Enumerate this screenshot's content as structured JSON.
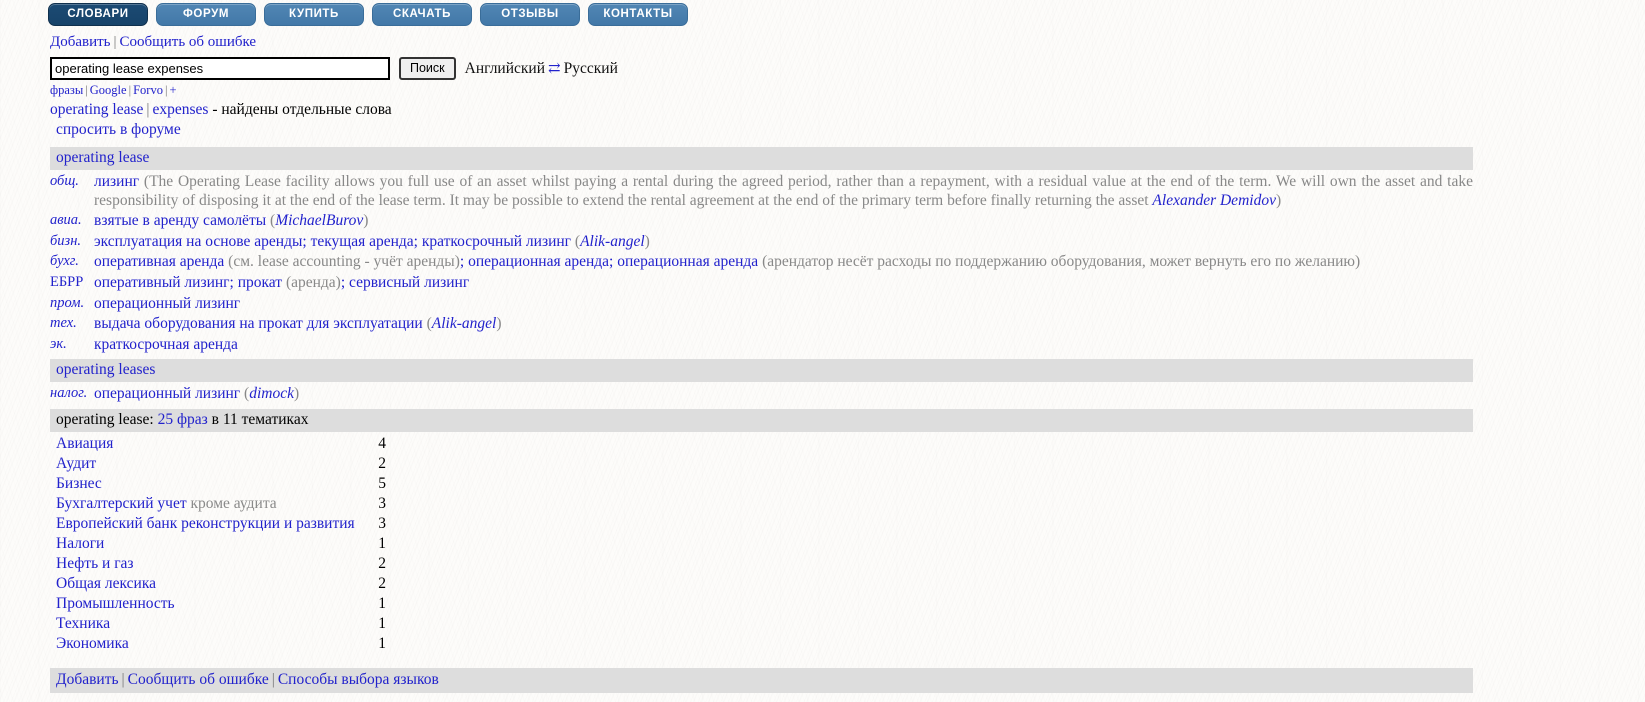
{
  "nav": {
    "items": [
      {
        "label": "СЛОВАРИ",
        "active": true
      },
      {
        "label": "ФОРУМ",
        "active": false
      },
      {
        "label": "КУПИТЬ",
        "active": false
      },
      {
        "label": "СКАЧАТЬ",
        "active": false
      },
      {
        "label": "ОТЗЫВЫ",
        "active": false
      },
      {
        "label": "КОНТАКТЫ",
        "active": false
      }
    ]
  },
  "toplinks": {
    "add": "Добавить",
    "divider": "|",
    "report": "Сообщить об ошибке"
  },
  "search": {
    "value": "operating lease expenses",
    "placeholder": "",
    "button": "Поиск",
    "lang_from": "Английский",
    "swap_icon": "⇄",
    "lang_to": "Русский"
  },
  "minilinks": {
    "phrases": "фразы",
    "google": "Google",
    "forvo": "Forvo",
    "plus": "+",
    "divider": "|"
  },
  "found": {
    "word1": "operating lease",
    "divider": "|",
    "word2": "expenses",
    "suffix": "- найдены отдельные слова",
    "ask_forum": "спросить в форуме"
  },
  "section1": {
    "header": "operating lease",
    "rows": [
      {
        "subject": "общ.",
        "parts": [
          {
            "t": "link",
            "v": "лизинг"
          },
          {
            "t": "gray",
            "v": " (The Operating Lease facility allows you full use of an asset whilst paying a rental during the agreed period, rather than a repayment, with a residual value at the end of the term. We will own the asset and take responsibility of disposing it at the end of the lease term. It may be possible to extend the rental agreement at the end of the primary term before finally returning the asset "
          },
          {
            "t": "author",
            "v": "Alexander Demidov"
          },
          {
            "t": "gray",
            "v": ")"
          }
        ]
      },
      {
        "subject": "авиа.",
        "parts": [
          {
            "t": "link",
            "v": "взятые в аренду самолёты"
          },
          {
            "t": "gray",
            "v": " ("
          },
          {
            "t": "author",
            "v": "MichaelBurov"
          },
          {
            "t": "gray",
            "v": ")"
          }
        ]
      },
      {
        "subject": "бизн.",
        "parts": [
          {
            "t": "link",
            "v": "эксплуатация на основе аренды"
          },
          {
            "t": "semi",
            "v": "; "
          },
          {
            "t": "link",
            "v": "текущая аренда"
          },
          {
            "t": "semi",
            "v": "; "
          },
          {
            "t": "link",
            "v": "краткосрочный лизинг"
          },
          {
            "t": "gray",
            "v": " ("
          },
          {
            "t": "author",
            "v": "Alik-angel"
          },
          {
            "t": "gray",
            "v": ")"
          }
        ]
      },
      {
        "subject": "бухг.",
        "parts": [
          {
            "t": "link",
            "v": "оперативная аренда"
          },
          {
            "t": "gray",
            "v": " (см. "
          },
          {
            "t": "graylink",
            "v": "lease accounting - учёт аренды"
          },
          {
            "t": "gray",
            "v": ")"
          },
          {
            "t": "semi",
            "v": "; "
          },
          {
            "t": "link",
            "v": "операционная аренда"
          },
          {
            "t": "semi",
            "v": "; "
          },
          {
            "t": "link",
            "v": "операционная аренда"
          },
          {
            "t": "gray",
            "v": " (арендатор несёт расходы по поддержанию оборудования, может вернуть его по желанию)"
          }
        ]
      },
      {
        "subject": "ЕБРР",
        "subject_nonitalic": true,
        "parts": [
          {
            "t": "link",
            "v": "оперативный лизинг"
          },
          {
            "t": "semi",
            "v": "; "
          },
          {
            "t": "link",
            "v": "прокат"
          },
          {
            "t": "gray",
            "v": " (аренда)"
          },
          {
            "t": "semi",
            "v": "; "
          },
          {
            "t": "link",
            "v": "сервисный лизинг"
          }
        ]
      },
      {
        "subject": "пром.",
        "parts": [
          {
            "t": "link",
            "v": "операционный лизинг"
          }
        ]
      },
      {
        "subject": "тех.",
        "parts": [
          {
            "t": "link",
            "v": "выдача оборудования на прокат для эксплуатации"
          },
          {
            "t": "gray",
            "v": " ("
          },
          {
            "t": "author",
            "v": "Alik-angel"
          },
          {
            "t": "gray",
            "v": ")"
          }
        ]
      },
      {
        "subject": "эк.",
        "parts": [
          {
            "t": "link",
            "v": "краткосрочная аренда"
          }
        ]
      }
    ]
  },
  "section2": {
    "header": "operating leases",
    "rows": [
      {
        "subject": "налог.",
        "parts": [
          {
            "t": "link",
            "v": "операционный лизинг"
          },
          {
            "t": "gray",
            "v": " ("
          },
          {
            "t": "author",
            "v": "dimock"
          },
          {
            "t": "gray",
            "v": ")"
          }
        ]
      }
    ]
  },
  "phrases": {
    "term": "operating lease:",
    "count_link": "25 фраз",
    "suffix": "в 11 тематиках",
    "topics": [
      {
        "name": "Авиация",
        "qualifier": "",
        "count": "4"
      },
      {
        "name": "Аудит",
        "qualifier": "",
        "count": "2"
      },
      {
        "name": "Бизнес",
        "qualifier": "",
        "count": "5"
      },
      {
        "name": "Бухгалтерский учет",
        "qualifier": "кроме аудита",
        "count": "3"
      },
      {
        "name": "Европейский банк реконструкции и развития",
        "qualifier": "",
        "count": "3"
      },
      {
        "name": "Налоги",
        "qualifier": "",
        "count": "1"
      },
      {
        "name": "Нефть и газ",
        "qualifier": "",
        "count": "2"
      },
      {
        "name": "Общая лексика",
        "qualifier": "",
        "count": "2"
      },
      {
        "name": "Промышленность",
        "qualifier": "",
        "count": "1"
      },
      {
        "name": "Техника",
        "qualifier": "",
        "count": "1"
      },
      {
        "name": "Экономика",
        "qualifier": "",
        "count": "1"
      }
    ]
  },
  "footer": {
    "add": "Добавить",
    "report": "Сообщить об ошибке",
    "langmodes": "Способы выбора языков",
    "divider": "|"
  },
  "colors": {
    "link": "#2222cc",
    "nav_active": "#1c4a73",
    "nav": "#4a80b0",
    "bar": "#dddddd",
    "gray_text": "#888888"
  }
}
